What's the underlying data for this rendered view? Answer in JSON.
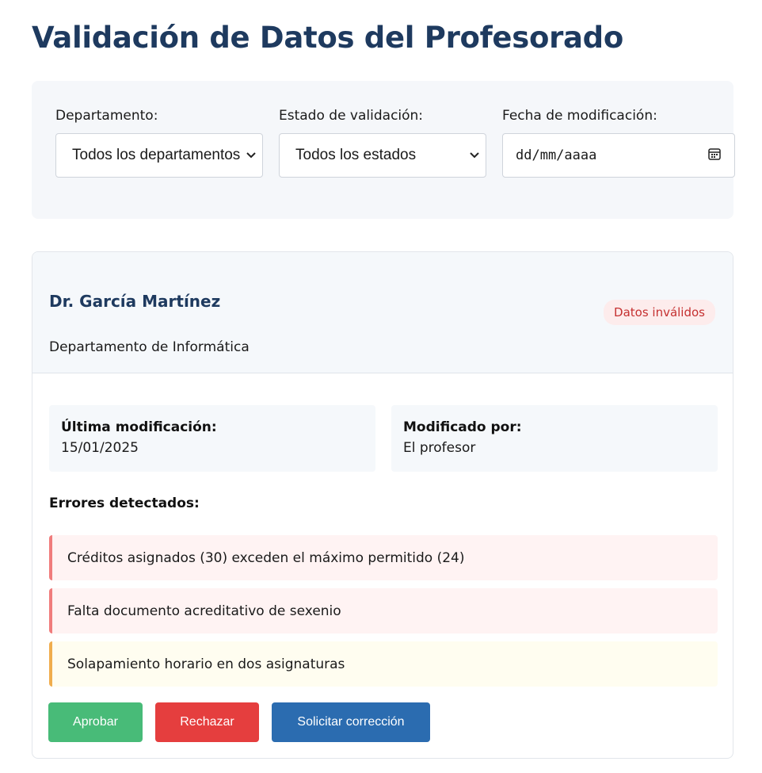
{
  "page": {
    "title": "Validación de Datos del Profesorado"
  },
  "filters": {
    "department": {
      "label": "Departamento:",
      "value": "Todos los departamentos"
    },
    "status": {
      "label": "Estado de validación:",
      "value": "Todos los estados"
    },
    "date": {
      "label": "Fecha de modificación:",
      "placeholder": "dd/mm/aaaa"
    }
  },
  "professor": {
    "name": "Dr. García Martínez",
    "department": "Departamento de Informática",
    "status_badge": "Datos inválidos",
    "last_modified_label": "Última modificación:",
    "last_modified_value": "15/01/2025",
    "modified_by_label": "Modificado por:",
    "modified_by_value": "El profesor",
    "errors_title": "Errores detectados:",
    "errors": [
      {
        "text": "Créditos asignados (30) exceden el máximo permitido (24)",
        "severity": "error"
      },
      {
        "text": "Falta documento acreditativo de sexenio",
        "severity": "error"
      },
      {
        "text": "Solapamiento horario en dos asignaturas",
        "severity": "warning"
      }
    ]
  },
  "actions": {
    "approve": "Aprobar",
    "reject": "Rechazar",
    "request_correction": "Solicitar corrección"
  },
  "colors": {
    "title": "#1e3a5f",
    "approve": "#48bb78",
    "reject": "#e53e3e",
    "request_correction": "#2b6cb0",
    "error_border": "#f07c7c",
    "warning_border": "#f0ad4e",
    "badge_text": "#c53030"
  },
  "icons": {
    "select_arrow": "chevron-down-icon",
    "date_picker": "calendar-icon"
  }
}
